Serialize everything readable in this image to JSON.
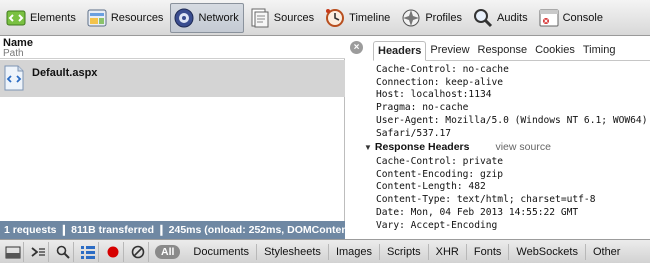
{
  "toolbar": {
    "items": [
      {
        "label": "Elements",
        "icon": "elements-icon"
      },
      {
        "label": "Resources",
        "icon": "resources-icon"
      },
      {
        "label": "Network",
        "icon": "network-icon",
        "selected": true
      },
      {
        "label": "Sources",
        "icon": "sources-icon"
      },
      {
        "label": "Timeline",
        "icon": "timeline-icon"
      },
      {
        "label": "Profiles",
        "icon": "profiles-icon"
      },
      {
        "label": "Audits",
        "icon": "audits-icon"
      },
      {
        "label": "Console",
        "icon": "console-icon"
      }
    ]
  },
  "requests": {
    "col_name": "Name",
    "col_path": "Path",
    "rows": [
      {
        "name": "Default.aspx",
        "icon": "document-icon"
      }
    ],
    "summary": "1 requests ❙ 811B transferred ❙ 245ms (onload: 252ms, DOMContentLoaded: 251ms)"
  },
  "details": {
    "tabs": [
      "Headers",
      "Preview",
      "Response",
      "Cookies",
      "Timing"
    ],
    "active_tab": "Headers",
    "request_headers": [
      "Cache-Control: no-cache",
      "Connection: keep-alive",
      "Host: localhost:1134",
      "Pragma: no-cache",
      "User-Agent: Mozilla/5.0 (Windows NT 6.1; WOW64)",
      "Safari/537.17"
    ],
    "response_section_title": "Response Headers",
    "view_source_label": "view source",
    "response_headers": [
      "Cache-Control: private",
      "Content-Encoding: gzip",
      "Content-Length: 482",
      "Content-Type: text/html; charset=utf-8",
      "Date: Mon, 04 Feb 2013 14:55:22 GMT",
      "Vary: Accept-Encoding"
    ]
  },
  "bottom": {
    "filter_all": "All",
    "filters": [
      "Documents",
      "Stylesheets",
      "Images",
      "Scripts",
      "XHR",
      "Fonts",
      "WebSockets",
      "Other"
    ]
  },
  "colors": {
    "status_strip": "#6f88a3",
    "record_dot": "#d60000"
  }
}
